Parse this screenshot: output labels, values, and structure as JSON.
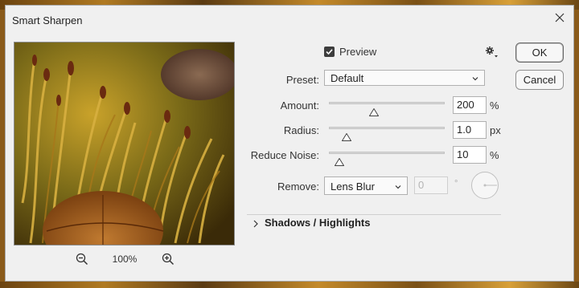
{
  "window": {
    "title": "Smart Sharpen"
  },
  "preview": {
    "label": "Preview",
    "checked": true
  },
  "buttons": {
    "ok": "OK",
    "cancel": "Cancel"
  },
  "preset": {
    "label": "Preset:",
    "value": "Default"
  },
  "amount": {
    "label": "Amount:",
    "value": "200",
    "unit": "%"
  },
  "radius": {
    "label": "Radius:",
    "value": "1.0",
    "unit": "px"
  },
  "reduce_noise": {
    "label": "Reduce Noise:",
    "value": "10",
    "unit": "%"
  },
  "remove": {
    "label": "Remove:",
    "value": "Lens Blur",
    "angle": "0",
    "angle_unit": "°"
  },
  "section": {
    "label": "Shadows / Highlights"
  },
  "zoom": {
    "level": "100%"
  },
  "icons": {
    "close": "close-icon",
    "gear": "gear-icon",
    "zoom_out": "zoom-out-icon",
    "zoom_in": "zoom-in-icon",
    "chevron": "chevron-down-icon",
    "expand": "chevron-right-icon"
  },
  "colors": {
    "checkbox": "#3d3d3d",
    "dialog_bg": "#f0f0f0"
  }
}
